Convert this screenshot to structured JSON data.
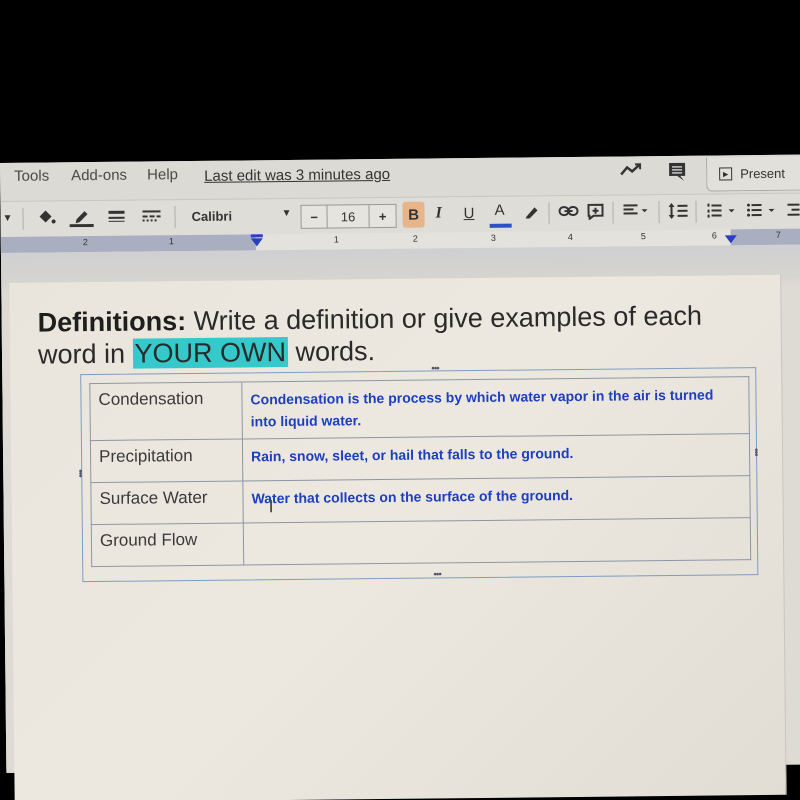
{
  "menu": {
    "items": [
      "Tools",
      "Add-ons",
      "Help"
    ],
    "last_edit": "Last edit was 3 minutes ago",
    "present_label": "Present"
  },
  "icons": {
    "activity": "activity-trend-icon",
    "comments": "comment-icon",
    "present": "play-icon"
  },
  "toolbar": {
    "font": "Calibri",
    "font_size": "16",
    "minus": "−",
    "plus": "+",
    "bold": "B",
    "italic": "I",
    "underline": "U",
    "text_color": "A",
    "text_color_hex": "#2a52c6",
    "bold_active_bg": "#e8b48a"
  },
  "ruler": {
    "left_labels": [
      "2",
      "1"
    ],
    "right_labels": [
      "1",
      "2",
      "3",
      "4",
      "5",
      "6",
      "7"
    ]
  },
  "document": {
    "heading_bold": "Definitions:",
    "heading_rest": " Write a definition or give examples of each word in ",
    "heading_highlight": "YOUR OWN",
    "heading_end": " words.",
    "highlight_color": "#36c9cc",
    "definition_color": "#1d3fbf",
    "table": {
      "rows": [
        {
          "term": "Condensation",
          "definition": "Condensation is the process by which water vapor in the air is turned into liquid water."
        },
        {
          "term": "Precipitation",
          "definition": "Rain, snow, sleet, or hail that falls to the ground."
        },
        {
          "term": "Surface Water",
          "definition": "Water that collects on the surface of the ground."
        },
        {
          "term": "Ground Flow",
          "definition": ""
        }
      ]
    }
  }
}
